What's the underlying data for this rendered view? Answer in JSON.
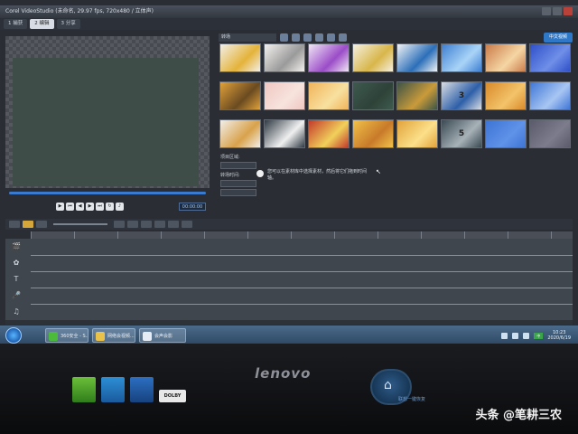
{
  "app": {
    "title": "Corel VideoStudio  (未命名, 29.97 fps, 720x480 / 立体声)",
    "steps": [
      {
        "label": "1 捕获",
        "active": false
      },
      {
        "label": "2 编辑",
        "active": true
      },
      {
        "label": "3 分享",
        "active": false
      }
    ]
  },
  "preview": {
    "timecode": "00:00:00"
  },
  "library": {
    "category": "转场",
    "brand": "中文视频",
    "thumbnails": [
      {
        "label": "",
        "color": "#f2efe8",
        "accent": "#e4b33a"
      },
      {
        "label": "",
        "color": "#f3f1ee",
        "accent": "#9a9a9a"
      },
      {
        "label": "",
        "color": "#efe6f4",
        "accent": "#9b4cc8"
      },
      {
        "label": "",
        "color": "#f5f0df",
        "accent": "#d8b64a"
      },
      {
        "label": "",
        "color": "#f1f3f6",
        "accent": "#2b6fb8"
      },
      {
        "label": "",
        "color": "#3e7fd2",
        "accent": "#a9d4f7"
      },
      {
        "label": "",
        "color": "#c97b4a",
        "accent": "#f5d6a4"
      },
      {
        "label": "",
        "color": "#2f4fc9",
        "accent": "#6f8fe8"
      },
      {
        "label": "",
        "color": "#e0a23a",
        "accent": "#6a4a20"
      },
      {
        "label": "",
        "color": "#f0c7c2",
        "accent": "#f7e3dd"
      },
      {
        "label": "",
        "color": "#f1b45a",
        "accent": "#f8e0a0"
      },
      {
        "label": "",
        "color": "#3e5a4e",
        "accent": "#2e4238"
      },
      {
        "label": "",
        "color": "#3c5446",
        "accent": "#c99b3a"
      },
      {
        "label": "3",
        "color": "#d9dde3",
        "accent": "#2d5fa8"
      },
      {
        "label": "",
        "color": "#d88a2a",
        "accent": "#f3c36a"
      },
      {
        "label": "",
        "color": "#3f76d6",
        "accent": "#a8c6f2"
      },
      {
        "label": "",
        "color": "#f2efea",
        "accent": "#d8a24a"
      },
      {
        "label": "",
        "color": "#2f3a44",
        "accent": "#f0f0f0"
      },
      {
        "label": "",
        "color": "#c23a2a",
        "accent": "#f0d05a"
      },
      {
        "label": "",
        "color": "#f1c24a",
        "accent": "#c87a2a"
      },
      {
        "label": "",
        "color": "#e2a23a",
        "accent": "#fbe08a"
      },
      {
        "label": "5",
        "color": "#3a4a52",
        "accent": "#a7b1b8"
      },
      {
        "label": "",
        "color": "#3d74d4",
        "accent": "#5f92e8"
      },
      {
        "label": "",
        "color": "#5a5a6a",
        "accent": "#7c7c8c"
      }
    ],
    "options": {
      "option1_label": "项目区域:",
      "option2_label": "转场时间:",
      "hint": "您可以在素材库中选择素材，然后将它们拖到时间轴。"
    }
  },
  "timeline": {
    "track_icons": [
      "🎬",
      "✿",
      "T",
      "🎤",
      "♫"
    ]
  },
  "taskbar": {
    "tasks": [
      {
        "label": "360安全 - S...",
        "color": "#4cba3b"
      },
      {
        "label": "网络会视频...",
        "color": "#e8c24a"
      },
      {
        "label": "会声会影",
        "color": "#e6ecf3"
      }
    ],
    "tray_badge": "中",
    "time": "10:23",
    "date": "2020/6/19"
  },
  "monitor": {
    "brand": "lenovo",
    "button_label": "联想一键恢复",
    "sticker4": "DOLBY"
  },
  "watermark": "头条 @笔耕三农"
}
